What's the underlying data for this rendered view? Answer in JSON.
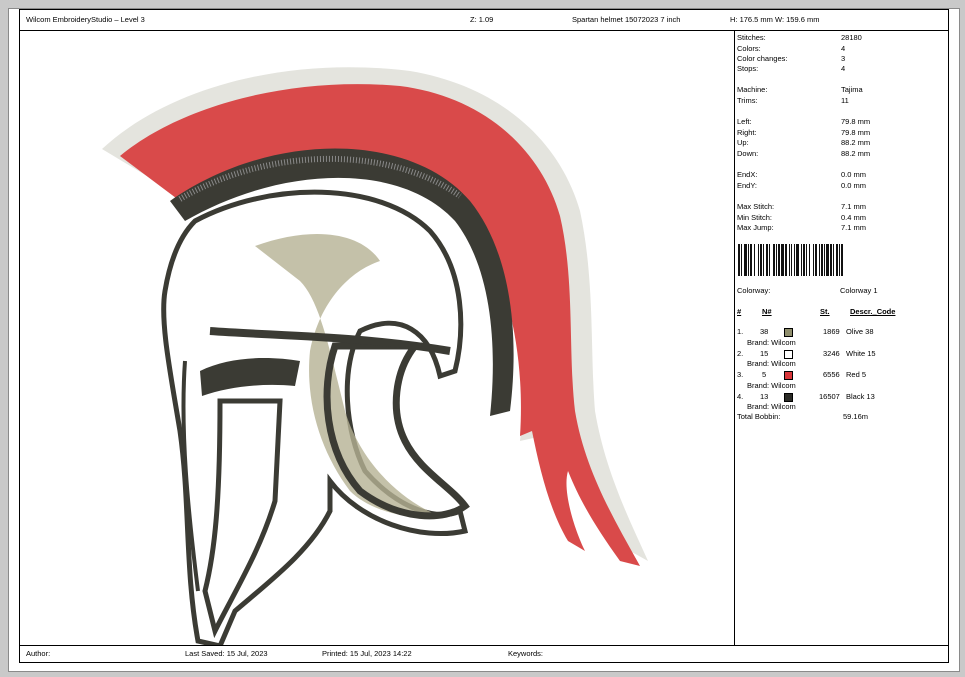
{
  "header": {
    "app_title": "Wilcom EmbroideryStudio – Level 3",
    "zoom": "Z: 1.09",
    "design_name": "Spartan helmet 15072023 7 inch",
    "size": "H: 176.5 mm   W: 159.6 mm"
  },
  "stats": [
    {
      "label": "Stitches:",
      "value": "28180"
    },
    {
      "label": "Colors:",
      "value": "4"
    },
    {
      "label": "Color changes:",
      "value": "3"
    },
    {
      "label": "Stops:",
      "value": "4"
    },
    {
      "label": "Machine:",
      "value": "Tajima"
    },
    {
      "label": "Trims:",
      "value": "11"
    },
    {
      "label": "Left:",
      "value": "79.8 mm"
    },
    {
      "label": "Right:",
      "value": "79.8 mm"
    },
    {
      "label": "Up:",
      "value": "88.2 mm"
    },
    {
      "label": "Down:",
      "value": "88.2 mm"
    },
    {
      "label": "EndX:",
      "value": "0.0 mm"
    },
    {
      "label": "EndY:",
      "value": "0.0 mm"
    },
    {
      "label": "Max Stitch:",
      "value": "7.1 mm"
    },
    {
      "label": "Min Stitch:",
      "value": "0.4 mm"
    },
    {
      "label": "Max Jump:",
      "value": "7.1 mm"
    }
  ],
  "colorway": {
    "label": "Colorway:",
    "value": "Colorway 1"
  },
  "thread_table": {
    "headers": [
      "#",
      "N#",
      "St.",
      "Descr._Code"
    ],
    "rows": [
      {
        "idx": "1.",
        "n": "38",
        "color": "#8f8e6c",
        "stitches": "1869",
        "descr": "Olive 38",
        "brand": "Brand: Wilcom"
      },
      {
        "idx": "2.",
        "n": "15",
        "color": "#ffffff",
        "stitches": "3246",
        "descr": "White 15",
        "brand": "Brand: Wilcom"
      },
      {
        "idx": "3.",
        "n": "5",
        "color": "#d8363a",
        "stitches": "6556",
        "descr": "Red 5",
        "brand": "Brand: Wilcom"
      },
      {
        "idx": "4.",
        "n": "13",
        "color": "#2b2b26",
        "stitches": "16507",
        "descr": "Black 13",
        "brand": "Brand: Wilcom"
      }
    ],
    "total_label": "Total Bobbin:",
    "total_value": "59.16m"
  },
  "footer": {
    "author": "Author:",
    "last_saved": "Last Saved: 15 Jul, 2023",
    "printed": "Printed: 15 Jul, 2023 14:22",
    "keywords": "Keywords:"
  },
  "colors": {
    "plume_red": "#d94a4a",
    "plume_white": "#e2e2dc",
    "helmet_dark": "#3b3b34",
    "olive": "#b5b294"
  }
}
